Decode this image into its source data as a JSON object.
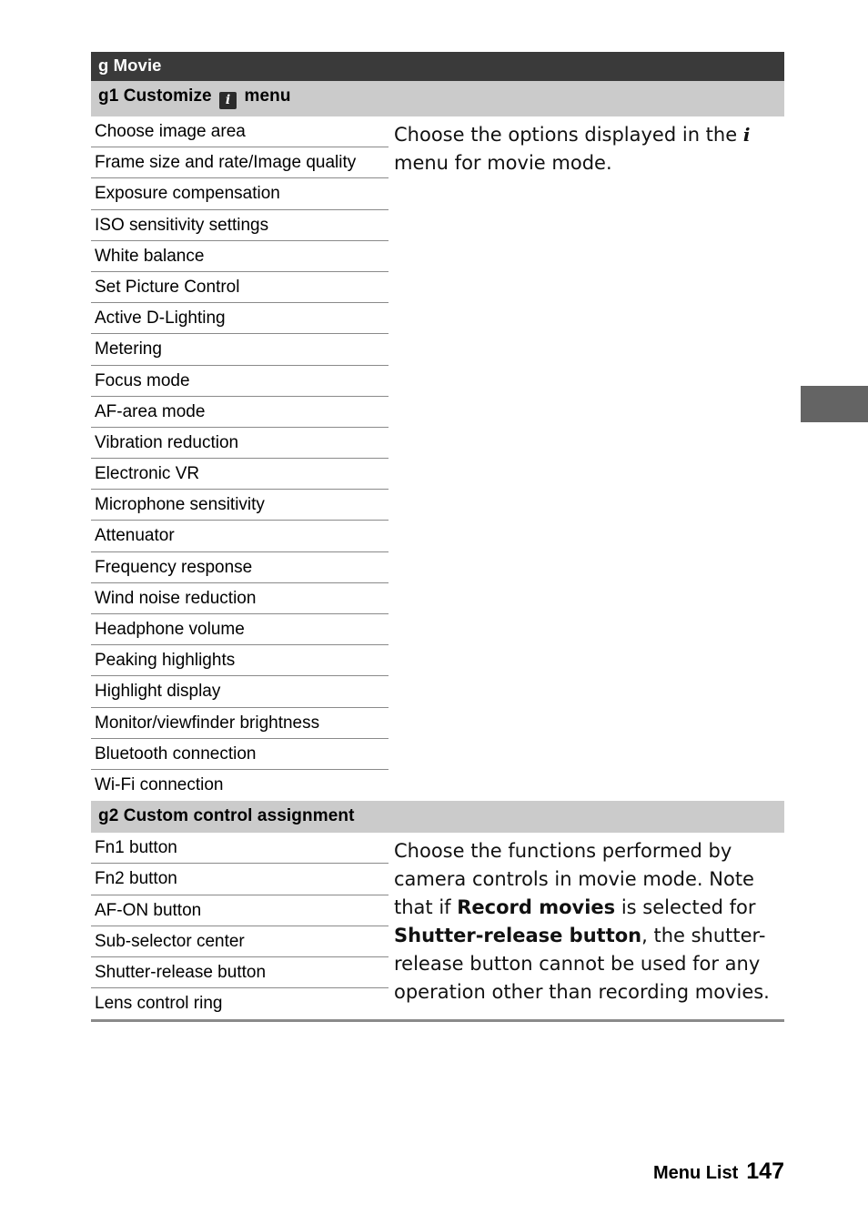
{
  "page": {
    "footer_label": "Menu List",
    "footer_page": "147",
    "edge_tab_color": "#646464"
  },
  "header": {
    "group_title": "g Movie",
    "group_bar_color": "#3a3a3a",
    "section_bar_color": "#cbcbcb"
  },
  "sections": [
    {
      "id": "g1",
      "title_prefix": "g1 Customize",
      "title_icon": "i",
      "title_suffix": "menu",
      "items": [
        "Choose image area",
        "Frame size and rate/Image quality",
        "Exposure compensation",
        "ISO sensitivity settings",
        "White balance",
        "Set Picture Control",
        "Active D-Lighting",
        "Metering",
        "Focus mode",
        "AF-area mode",
        "Vibration reduction",
        "Electronic VR",
        "Microphone sensitivity",
        "Attenuator",
        "Frequency response",
        "Wind noise reduction",
        "Headphone volume",
        "Peaking highlights",
        "Highlight display",
        "Monitor/viewfinder brightness",
        "Bluetooth connection",
        "Wi-Fi connection"
      ],
      "description_part1": "Choose the options displayed in the ",
      "description_icon": "i",
      "description_part2": " menu for movie mode."
    },
    {
      "id": "g2",
      "title": "g2 Custom control assignment",
      "items": [
        "Fn1 button",
        "Fn2 button",
        "AF-ON button",
        "Sub-selector center",
        "Shutter-release button",
        "Lens control ring"
      ],
      "description_segments": [
        {
          "text": "Choose the functions performed by camera controls in movie mode. Note that if ",
          "bold": false
        },
        {
          "text": "Record movies",
          "bold": true
        },
        {
          "text": " is selected for ",
          "bold": false
        },
        {
          "text": "Shutter-release button",
          "bold": true
        },
        {
          "text": ", the shutter-release button cannot be used for any operation other than recording movies.",
          "bold": false
        }
      ]
    }
  ]
}
